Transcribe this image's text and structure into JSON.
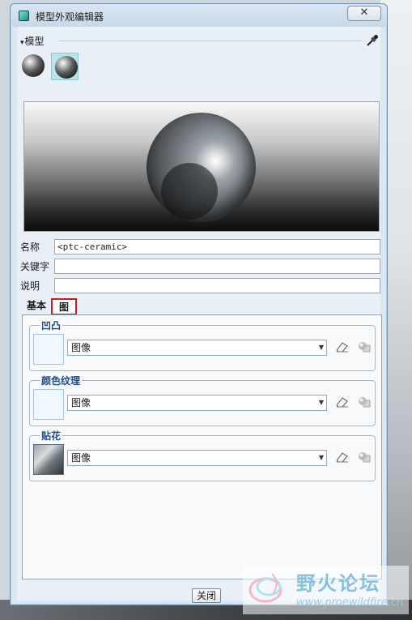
{
  "window": {
    "title": "模型外观编辑器",
    "close_glyph": "✕"
  },
  "model_section": {
    "label": "模型",
    "toggle_glyph": "▾"
  },
  "fields": {
    "name_label": "名称",
    "name_value": "<ptc-ceramic>",
    "keyword_label": "关键字",
    "keyword_value": "",
    "description_label": "说明",
    "description_value": ""
  },
  "tabs": {
    "basic": "基本",
    "map": "图",
    "active": "图"
  },
  "groups": [
    {
      "title": "凹凸",
      "select_value": "图像"
    },
    {
      "title": "颜色纹理",
      "select_value": "图像"
    },
    {
      "title": "贴花",
      "select_value": "图像"
    }
  ],
  "footer": {
    "close_label": "关闭"
  },
  "watermark": {
    "title": "野火论坛",
    "url": "www.proewildfire.cn"
  },
  "colors": {
    "tab_highlight": "#d11a1a",
    "group_title": "#1f4f86",
    "window_frame": "#6f8fae"
  }
}
